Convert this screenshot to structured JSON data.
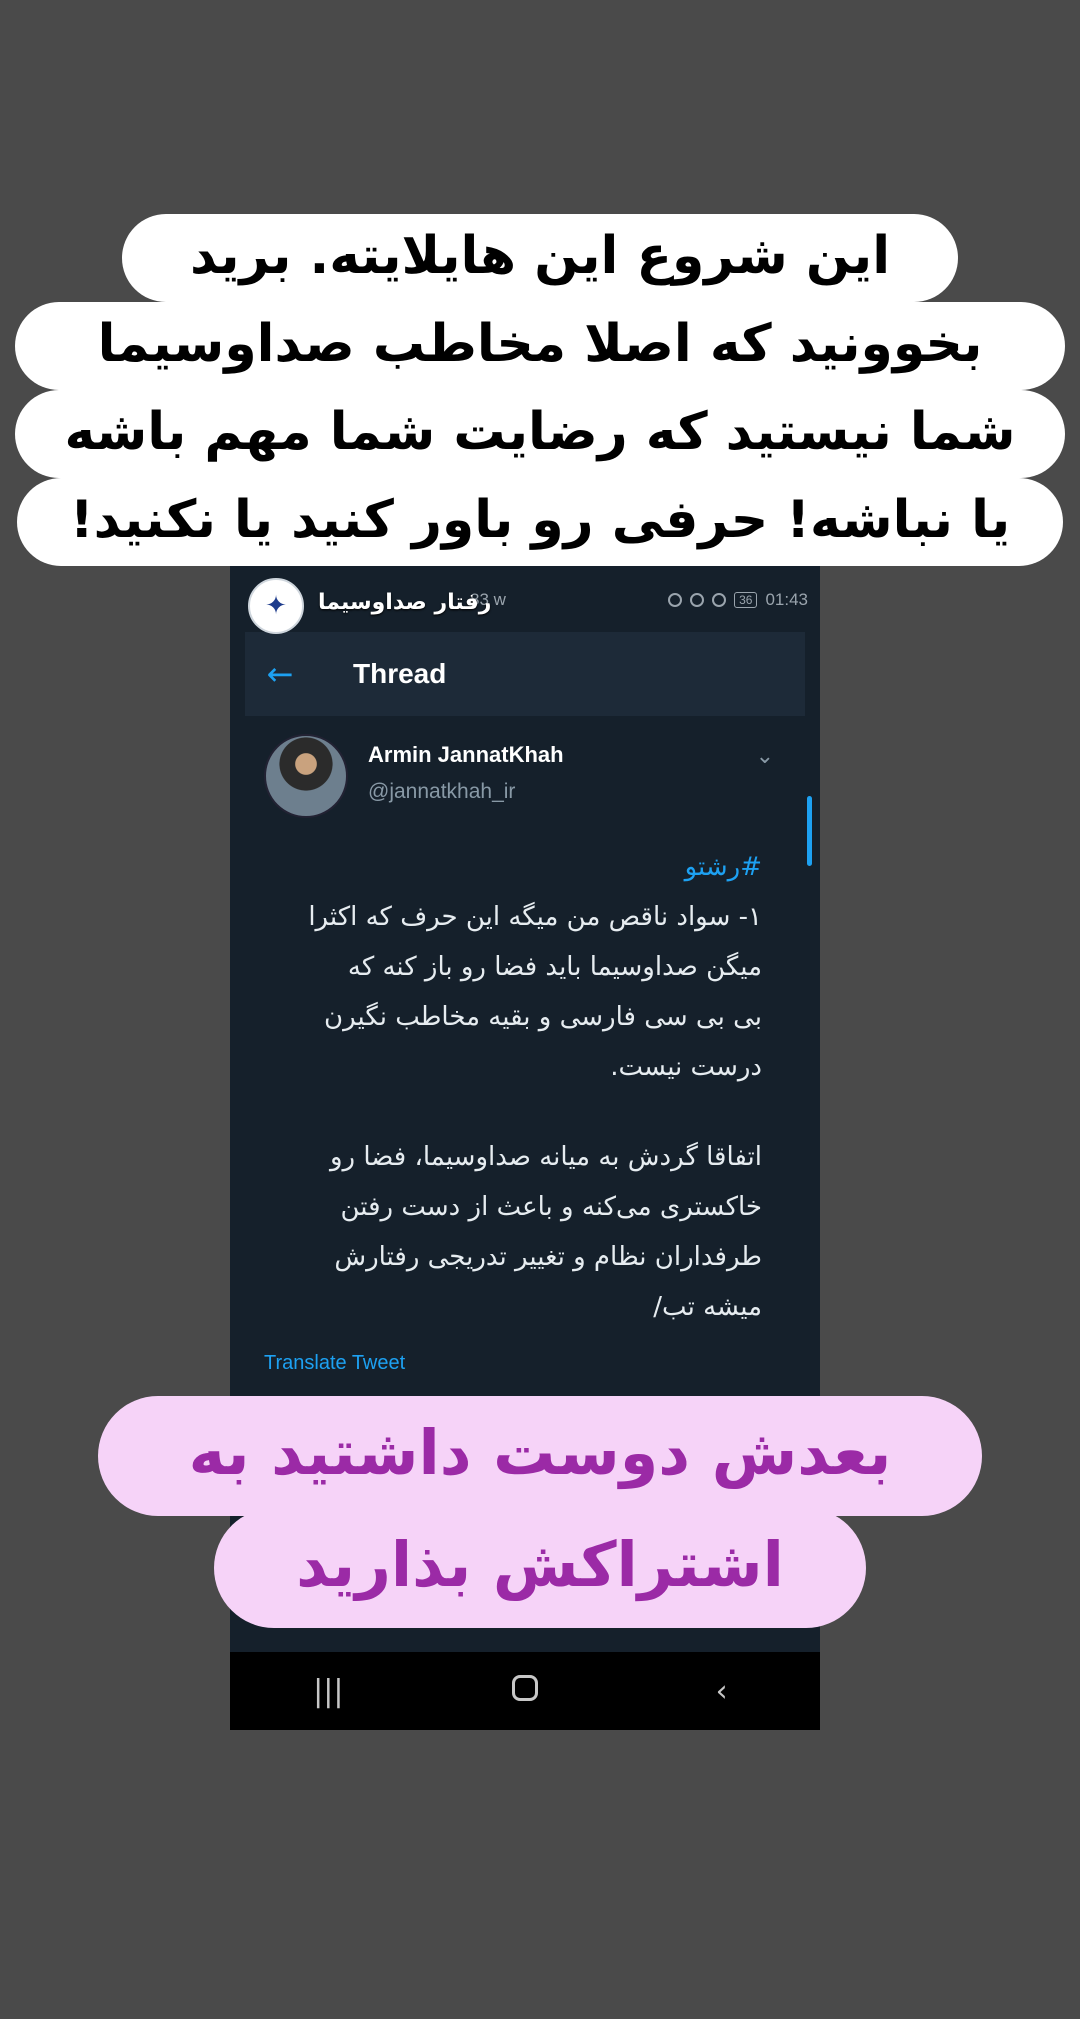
{
  "caption_top": {
    "lines": [
      "این شروع این هایلایته. برید",
      "بخوونید که اصلا مخاطب صداوسیما",
      "شما نیستید که رضایت شما مهم باشه",
      "یا نباشه! حرفی رو باور کنید یا نکنید!"
    ]
  },
  "overlay_account": {
    "name": "رفتار صداوسیما"
  },
  "statusbar": {
    "data_speed": "83 w",
    "time": "01:43",
    "battery": "36"
  },
  "appbar": {
    "title": "Thread"
  },
  "tweet": {
    "author_name": "Armin JannatKhah",
    "handle": "@jannatkhah_ir",
    "hashtag": "#رشتو",
    "paragraph1": "۱- سواد ناقص من میگه این حرف که اکثرا\nمیگن صداوسیما باید فضا رو باز کنه که\nبی بی سی فارسی و بقیه مخاطب نگیرن\nدرست نیست.",
    "paragraph2": "اتفاقا گردش به میانه صداوسیما، فضا رو\nخاکستری می‌کنه و باعث از دست رفتن\nطرفداران نظام و تغییر تدریجی رفتارش\nمیشه تب/",
    "translate_label": "Translate Tweet"
  },
  "caption_bottom": {
    "lines": [
      "بعدش دوست داشتید به",
      "اشتراکش بذارید"
    ]
  }
}
